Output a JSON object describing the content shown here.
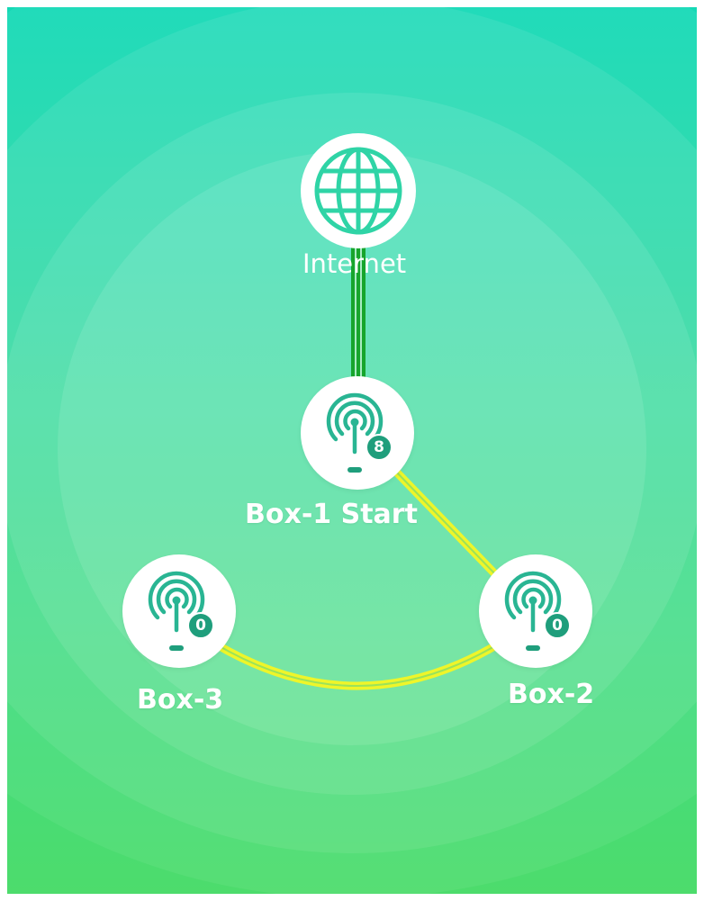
{
  "colors": {
    "background_top": "#14d9b6",
    "background_bottom": "#4ddc6c",
    "wired_link": "#17a52c",
    "wireless_link": "#eef52a",
    "node_icon": "#29b593",
    "badge": "#1f9e7c"
  },
  "internet": {
    "label": "Internet",
    "icon": "globe-icon"
  },
  "nodes": [
    {
      "label": "Box-1 Start",
      "device_count": "8",
      "icon": "router-antenna-icon"
    },
    {
      "label": "Box-2",
      "device_count": "0",
      "icon": "router-antenna-icon"
    },
    {
      "label": "Box-3",
      "device_count": "0",
      "icon": "router-antenna-icon"
    }
  ],
  "links": [
    {
      "from": "Internet",
      "to": "Box-1 Start",
      "type": "wired"
    },
    {
      "from": "Box-1 Start",
      "to": "Box-2",
      "type": "wireless"
    },
    {
      "from": "Box-2",
      "to": "Box-3",
      "type": "wireless"
    }
  ]
}
